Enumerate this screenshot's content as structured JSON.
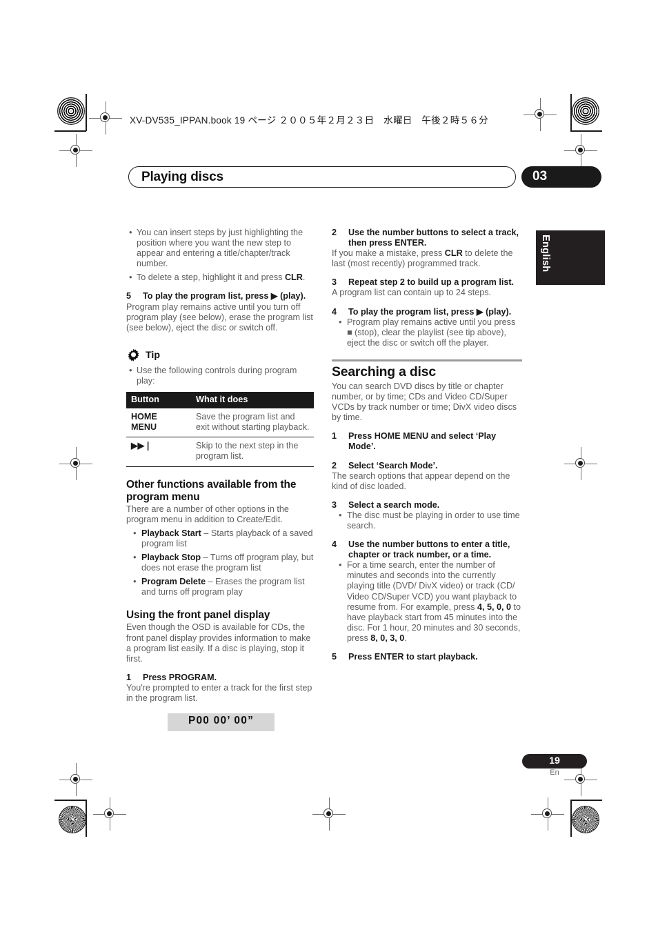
{
  "document": {
    "running_head": "XV-DV535_IPPAN.book 19 ページ ２００５年２月２３日　水曜日　午後２時５６分",
    "chapter_title": "Playing discs",
    "chapter_number": "03",
    "language_tab": "English",
    "page_number": "19",
    "page_language_code": "En",
    "accent_dark": "#231f20",
    "body_gray": "#57585a",
    "rule_gray": "#9a9a9a",
    "display_panel_gray": "#d6d6d6"
  },
  "left_column": {
    "intro_bullets": [
      "You can insert steps by just highlighting the position where you want the new step to appear and entering a title/chapter/track number.",
      "To delete a step, highlight it and press CLR."
    ],
    "step5": {
      "number": "5",
      "heading": "To play the program list, press ▶ (play).",
      "body": "Program play remains active until you turn off program play (see below), erase the program list (see below), eject the disc or switch off."
    },
    "tip": {
      "icon": "gear-icon",
      "label": "Tip",
      "bullet": "Use the following controls during program play:"
    },
    "button_table": {
      "headers": [
        "Button",
        "What it does"
      ],
      "rows": [
        {
          "button": "HOME MENU",
          "does": "Save the program list and exit without starting playback."
        },
        {
          "button": "▶▶❘",
          "does": "Skip to the next step in the program list."
        }
      ]
    },
    "other_functions": {
      "heading": "Other functions available from the program menu",
      "body": "There are a number of other options in the program menu in addition to Create/Edit.",
      "bullets": [
        {
          "term": "Playback Start",
          "desc": " – Starts playback of a saved program list"
        },
        {
          "term": "Playback Stop",
          "desc": " – Turns off program play, but does not erase the program list"
        },
        {
          "term": "Program Delete",
          "desc": " – Erases the program list and turns off program play"
        }
      ]
    },
    "front_panel": {
      "heading": "Using the front panel display",
      "body": "Even though the OSD is available for CDs, the front panel display provides information to make a program list easily. If a disc is playing, stop it first.",
      "step1": {
        "number": "1",
        "heading": "Press PROGRAM.",
        "body": "You're prompted to enter a track for the first step in the program list."
      },
      "display_readout": "P00    00’ 00”"
    }
  },
  "right_column": {
    "step2": {
      "number": "2",
      "heading": "Use the number buttons to select a track, then press ENTER.",
      "body_pre": "If you make a mistake, press ",
      "body_bold": "CLR",
      "body_post": " to delete the last (most recently) programmed track."
    },
    "step3": {
      "number": "3",
      "heading": "Repeat step 2 to build up a program list.",
      "body": "A program list can contain up to 24 steps."
    },
    "step4": {
      "number": "4",
      "heading": "To play the program list, press ▶ (play).",
      "bullet": "Program play remains active until you press ■ (stop), clear the playlist (see tip above), eject the disc or switch off the player."
    },
    "searching": {
      "heading": "Searching a disc",
      "body": "You can search DVD discs by title or chapter number, or by time; CDs and Video CD/Super VCDs by track number or time; DivX video discs by time.",
      "step1": {
        "number": "1",
        "heading": "Press HOME MENU and select ‘Play Mode’."
      },
      "step2": {
        "number": "2",
        "heading": "Select ‘Search Mode’.",
        "body": "The search options that appear depend on the kind of disc loaded."
      },
      "step3": {
        "number": "3",
        "heading": "Select a search mode.",
        "bullet": "The disc must be playing in order to use time search."
      },
      "step4": {
        "number": "4",
        "heading": "Use the number buttons to enter a title, chapter or track number, or a time.",
        "bullet_pre": "For a time search, enter the number of minutes and seconds into the currently playing title (DVD/ DivX video) or track (CD/ Video CD/Super VCD) you want playback to resume from. For example, press ",
        "bullet_keys1": "4, 5, 0, 0",
        "bullet_mid": " to have playback start from 45 minutes into the disc. For 1 hour, 20 minutes and 30 seconds, press ",
        "bullet_keys2": "8, 0, 3, 0",
        "bullet_end": "."
      },
      "step5": {
        "number": "5",
        "heading": "Press ENTER to start playback."
      }
    }
  }
}
